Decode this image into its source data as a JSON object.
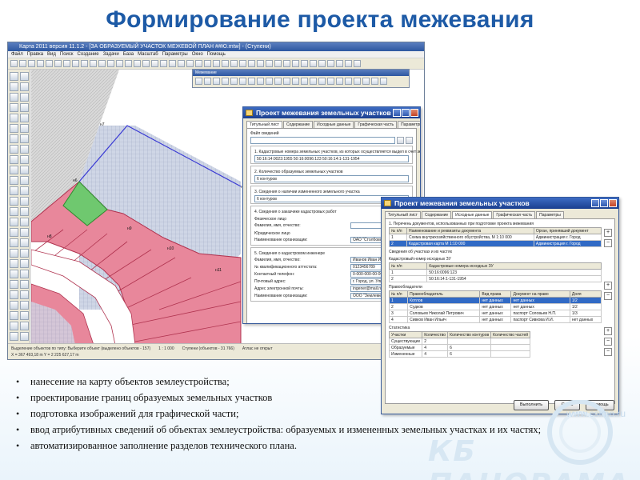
{
  "slide": {
    "title": "Формирование проекта межевания",
    "bullets": [
      "нанесение на карту объектов землеустройства;",
      "проектирование границ образуемых земельных участков",
      "подготовка изображений для графической части;",
      "ввод атрибутивных сведений об объектах землеустройства: образуемых и измененных земельных участках и их частях;",
      "автоматизированное заполнение разделов технического плана."
    ],
    "logo": {
      "url": "www.csimo.ru",
      "name": "КБ ПАНОРАМА"
    }
  },
  "gis_window": {
    "title": "Карта 2011 версия 11.1.2 - [ЗА  ОБРАЗУЕМЫЙ УЧАСТОК МЕЖЕВОЙ ПЛАН  ##Ю.mtw] - (Ступени)",
    "menu": [
      "Файл",
      "Правка",
      "Вид",
      "Поиск",
      "Создание",
      "Задачи",
      "База",
      "Масштаб",
      "Параметры",
      "Окно",
      "Помощь"
    ],
    "floating_toolbar_title": "Межевание",
    "status_line1": "Выделение объектов по типу: Выберите объект (выделено объектов - 157)",
    "status_scale": "1 : 1 000",
    "status_count": "Ступени (объектов - 31 766)",
    "status_layer": "Атлас не открыт",
    "status_coords": "X = 367 493,18 m   Y = 2 225 627,17 m",
    "point_labels": [
      "н6",
      "н7",
      "н8",
      "н9",
      "н10",
      "н11",
      "н12"
    ]
  },
  "dialog1": {
    "title": "Проект межевания земельных участков",
    "tabs": [
      "Титульный лист",
      "Содержание",
      "Исходные данные",
      "Графическая часть",
      "Параметры"
    ],
    "file_label": "Файл сведений",
    "s1_label": "1. Кадастровые номера земельных участков, из которых осуществляется выдел в счет земельных долей",
    "s1_value": "50:16:14:0023:1955 50:16:0096:123 50:16:14:1-131-1954",
    "s2_label": "2. Количество образуемых земельных участков",
    "s2_value": "6 контуров",
    "s3_label": "3. Сведения о наличии измененного земельного участка",
    "s3_value": "6 контуров",
    "s4_label": "4. Сведения о заказчике кадастровых работ",
    "s4_physical": "Физическое лицо",
    "s4_fio_label": "Фамилия, имя, отчество:",
    "s4_legal": "Юридическое лицо",
    "s4_org_label": "Наименование организации:",
    "s4_org_value": "ОАО \"Столбовская нива\"",
    "s5_label": "5. Сведения о кадастровом инженере",
    "eng": [
      {
        "label": "Фамилия, имя, отчество:",
        "value": "Иванов Иван Иванович"
      },
      {
        "label": "№ квалификационного аттестата:",
        "value": "0123456789"
      },
      {
        "label": "Контактный телефон:",
        "value": "0-000-000-00-00"
      },
      {
        "label": "Почтовый адрес:",
        "value": "г. Город, ул. Улица, д.1"
      },
      {
        "label": "Адрес электронной почты:",
        "value": "ingener@mail.ru"
      },
      {
        "label": "Наименование организации:",
        "value": "ООО \"Землемер\""
      }
    ]
  },
  "dialog2": {
    "title": "Проект межевания земельных участков",
    "tabs": [
      "Титульный лист",
      "Содержание",
      "Исходные данные",
      "Графическая часть",
      "Параметры"
    ],
    "docs_section": "1. Перечень документов, использованных при подготовке проекта межевания",
    "docs_headers": [
      "№ п/п",
      "Наименование и реквизиты документа",
      "Орган, принявший документ"
    ],
    "docs_rows": [
      [
        "1",
        "Схема внутрихозяйственного обустройства, М 1:10 000",
        "Администрация г. Город"
      ],
      [
        "2",
        "Кадастровая карта М 1:10 000",
        "Администрация г. Город"
      ]
    ],
    "src_section": "Сведения об участках и их частях",
    "src_sub": "Кадастровый номер исходных ЗУ",
    "src_headers": [
      "№ п/п",
      "Кадастровые номера исходных ЗУ"
    ],
    "src_rows": [
      [
        "1",
        "50:16:0096:123"
      ],
      [
        "2",
        "50:16:14:1-131-1954"
      ]
    ],
    "owners_section": "Правообладатели",
    "owners_headers": [
      "№ п/п",
      "Правообладатель",
      "Вид права",
      "Документ на право",
      "Доля"
    ],
    "owners_rows": [
      [
        "1",
        "Котлов",
        "нет данных",
        "нет данных",
        "1/2"
      ],
      [
        "2",
        "Судков",
        "нет данных",
        "нет данных",
        "1/2"
      ],
      [
        "3",
        "Соловьев Николай Петрович",
        "нет данных",
        "паспорт Соловьев Н.П.",
        "1/3"
      ],
      [
        "4",
        "Сивков Иван Ильич",
        "нет данных",
        "паспорт Сивкова И.И.",
        "нет данных"
      ]
    ],
    "stats_section": "Статистика",
    "stats_headers": [
      "Участки",
      "Количество",
      "Количество контуров",
      "Количество частей"
    ],
    "stats_rows": [
      [
        "Существующие",
        "2",
        "",
        ""
      ],
      [
        "Образуемые",
        "4",
        "6",
        ""
      ],
      [
        "Измененные",
        "4",
        "6",
        ""
      ]
    ],
    "buttons": [
      "Выполнить",
      "Отказ",
      "Помощь"
    ]
  }
}
